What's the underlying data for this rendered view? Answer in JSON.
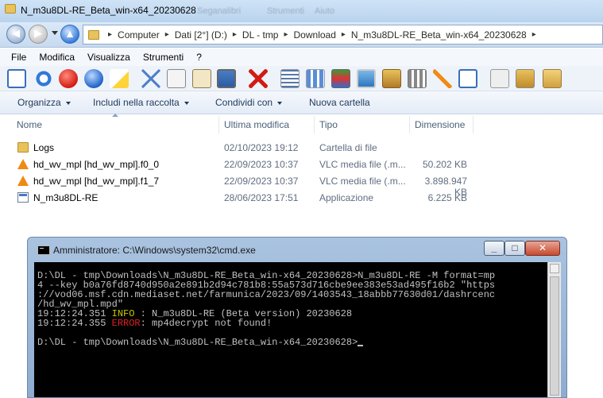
{
  "window": {
    "title": "N_m3u8DL-RE_Beta_win-x64_20230628",
    "ghost_text_1": "Seganalibri",
    "ghost_text_2": "Strumenti",
    "ghost_text_3": "Aiuto"
  },
  "address": {
    "segments": [
      "Computer",
      "Dati [2°] (D:)",
      "DL - tmp",
      "Download",
      "N_m3u8DL-RE_Beta_win-x64_20230628"
    ]
  },
  "menu": {
    "items": [
      "File",
      "Modifica",
      "Visualizza",
      "Strumenti",
      "?"
    ]
  },
  "toolbar_icons": [
    "panel-icon",
    "refresh-icon",
    "stop-icon",
    "up-icon",
    "new-icon",
    "cut-icon",
    "copy-icon",
    "paste-icon",
    "monitor-icon",
    "delete-icon",
    "details-icon",
    "list-icon",
    "thumbnails-icon",
    "image-icon",
    "folder-picture-icon",
    "filmstrip-icon",
    "check-icon",
    "window-icon",
    "pages-icon",
    "lock-icon",
    "folder-check-icon"
  ],
  "commands": {
    "organize": "Organizza",
    "include": "Includi nella raccolta",
    "share": "Condividi con",
    "new_folder": "Nuova cartella"
  },
  "columns": {
    "name": "Nome",
    "modified": "Ultima modifica",
    "type": "Tipo",
    "size": "Dimensione"
  },
  "files": [
    {
      "name": "Logs",
      "modified": "02/10/2023 19:12",
      "type": "Cartella di file",
      "size": "",
      "icon": "folder-icon"
    },
    {
      "name": "hd_wv_mpl [hd_wv_mpl].f0_0",
      "modified": "22/09/2023 10:37",
      "type": "VLC media file (.m...",
      "size": "50.202 KB",
      "icon": "vlc-icon"
    },
    {
      "name": "hd_wv_mpl [hd_wv_mpl].f1_7",
      "modified": "22/09/2023 10:37",
      "type": "VLC media file (.m...",
      "size": "3.898.947 KB",
      "icon": "vlc-icon"
    },
    {
      "name": "N_m3u8DL-RE",
      "modified": "28/06/2023 17:51",
      "type": "Applicazione",
      "size": "6.225 KB",
      "icon": "app-icon"
    }
  ],
  "cmd": {
    "title": "Amministratore: C:\\Windows\\system32\\cmd.exe",
    "line1": "D:\\DL - tmp\\Downloads\\N_m3u8DL-RE_Beta_win-x64_20230628>N_m3u8DL-RE -M format=mp",
    "line2": "4 --key b0a76fd8740d950a2e891b2d94c781b8:55a573d716cbe9ee383e53ad495f16b2 \"https",
    "line3": "://vod06.msf.cdn.mediaset.net/farmunica/2023/09/1403543_18abbb77630d01/dashrcenc",
    "line4": "/hd_wv_mpl.mpd\"",
    "log1_time": "19:12:24.351 ",
    "log1_level": "INFO",
    "log1_msg": " : N_m3u8DL-RE (Beta version) 20230628",
    "log2_time": "19:12:24.355 ",
    "log2_level": "ERROR",
    "log2_msg": ": mp4decrypt not found!",
    "prompt": "D:\\DL - tmp\\Downloads\\N_m3u8DL-RE_Beta_win-x64_20230628>"
  }
}
